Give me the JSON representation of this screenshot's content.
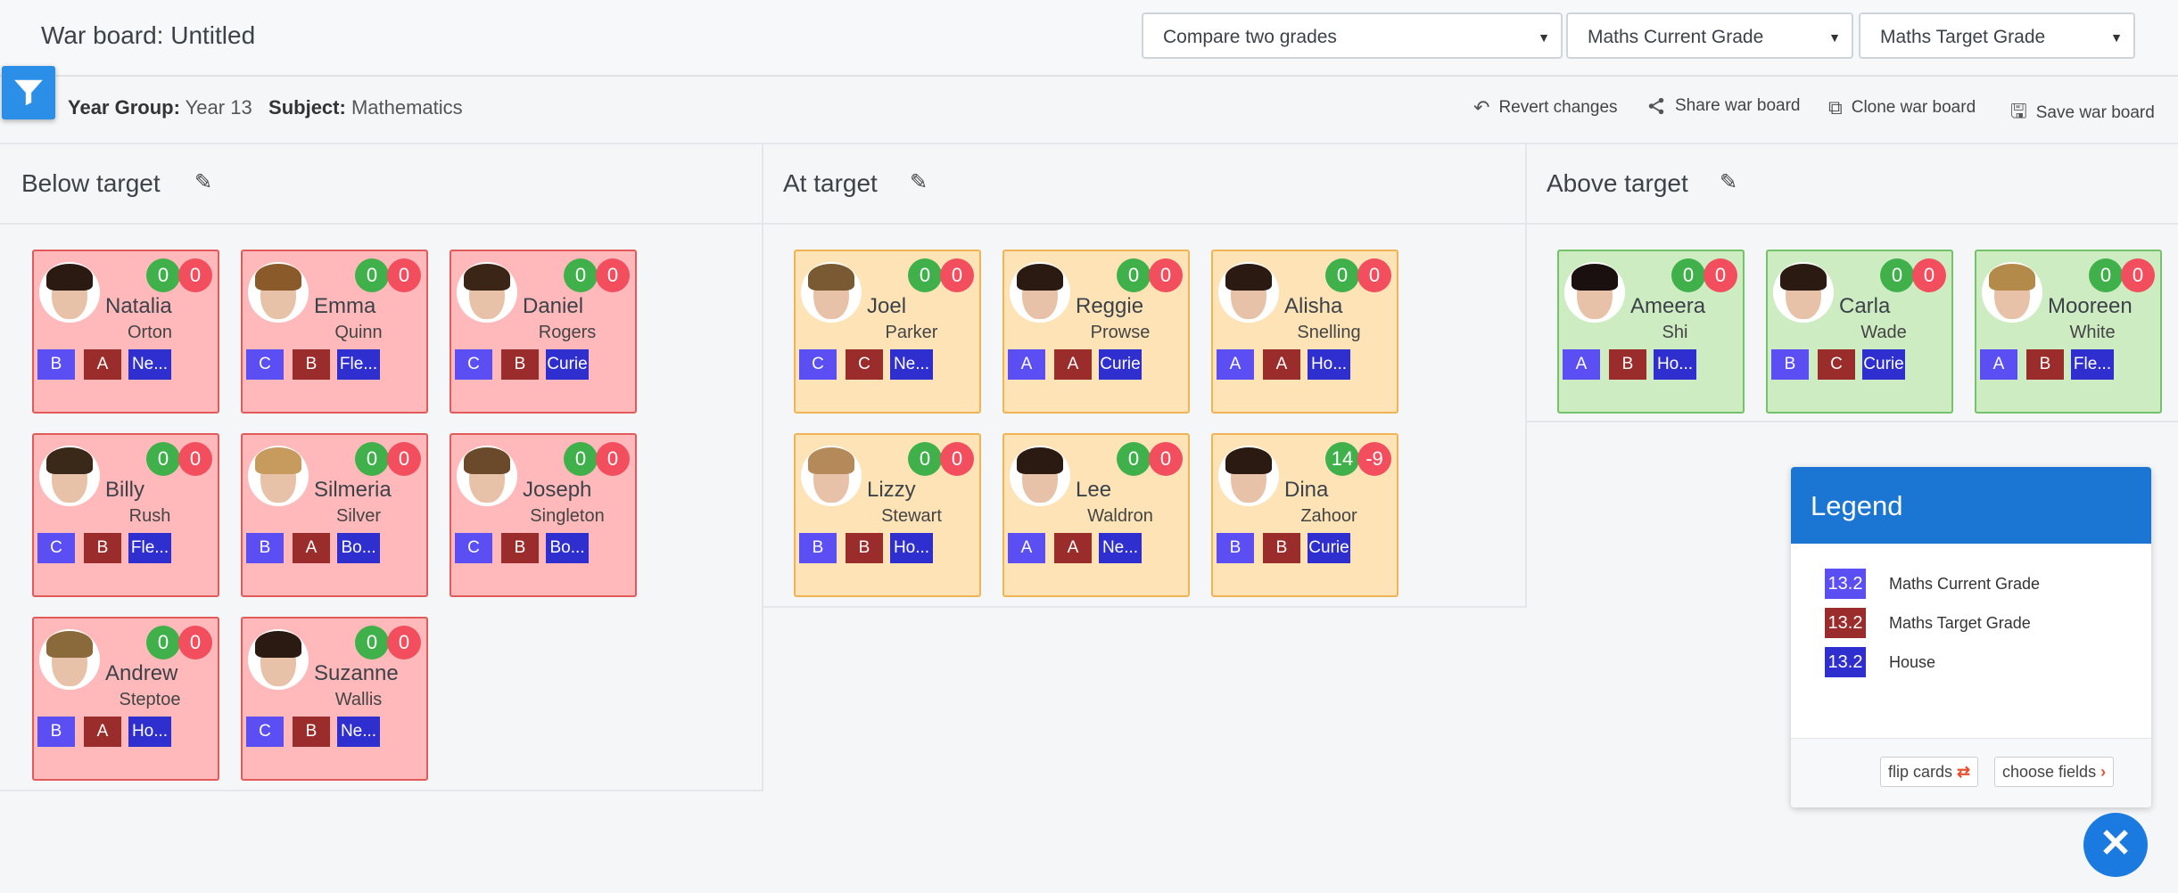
{
  "header": {
    "title": "War board: Untitled",
    "selects": [
      "Compare two grades",
      "Maths Current Grade",
      "Maths Target Grade"
    ]
  },
  "toolbar": {
    "year_group_label": "Year Group:",
    "year_group_value": "Year 13",
    "subject_label": "Subject:",
    "subject_value": "Mathematics",
    "actions": [
      "Revert changes",
      "Share war board",
      "Clone war board",
      "Save war board"
    ]
  },
  "columns": [
    {
      "title": "Below target"
    },
    {
      "title": "At target"
    },
    {
      "title": "Above target"
    }
  ],
  "cards": [
    {
      "first": "Natalia",
      "last": "Orton",
      "g": "0",
      "r": "0",
      "t1": "B",
      "t2": "A",
      "t3": "Ne...",
      "col": "red"
    },
    {
      "first": "Emma",
      "last": "Quinn",
      "g": "0",
      "r": "0",
      "t1": "C",
      "t2": "B",
      "t3": "Fle...",
      "col": "red"
    },
    {
      "first": "Daniel",
      "last": "Rogers",
      "g": "0",
      "r": "0",
      "t1": "C",
      "t2": "B",
      "t3": "Curie",
      "col": "red"
    },
    {
      "first": "Billy",
      "last": "Rush",
      "g": "0",
      "r": "0",
      "t1": "C",
      "t2": "B",
      "t3": "Fle...",
      "col": "red"
    },
    {
      "first": "Silmeria",
      "last": "Silver",
      "g": "0",
      "r": "0",
      "t1": "B",
      "t2": "A",
      "t3": "Bo...",
      "col": "red"
    },
    {
      "first": "Joseph",
      "last": "Singleton",
      "g": "0",
      "r": "0",
      "t1": "C",
      "t2": "B",
      "t3": "Bo...",
      "col": "red"
    },
    {
      "first": "Andrew",
      "last": "Steptoe",
      "g": "0",
      "r": "0",
      "t1": "B",
      "t2": "A",
      "t3": "Ho...",
      "col": "red"
    },
    {
      "first": "Suzanne",
      "last": "Wallis",
      "g": "0",
      "r": "0",
      "t1": "C",
      "t2": "B",
      "t3": "Ne...",
      "col": "red"
    },
    {
      "first": "Joel",
      "last": "Parker",
      "g": "0",
      "r": "0",
      "t1": "C",
      "t2": "C",
      "t3": "Ne...",
      "col": "amber"
    },
    {
      "first": "Reggie",
      "last": "Prowse",
      "g": "0",
      "r": "0",
      "t1": "A",
      "t2": "A",
      "t3": "Curie",
      "col": "amber"
    },
    {
      "first": "Alisha",
      "last": "Snelling",
      "g": "0",
      "r": "0",
      "t1": "A",
      "t2": "A",
      "t3": "Ho...",
      "col": "amber"
    },
    {
      "first": "Lizzy",
      "last": "Stewart",
      "g": "0",
      "r": "0",
      "t1": "B",
      "t2": "B",
      "t3": "Ho...",
      "col": "amber"
    },
    {
      "first": "Lee",
      "last": "Waldron",
      "g": "0",
      "r": "0",
      "t1": "A",
      "t2": "A",
      "t3": "Ne...",
      "col": "amber"
    },
    {
      "first": "Dina",
      "last": "Zahoor",
      "g": "14",
      "r": "-9",
      "t1": "B",
      "t2": "B",
      "t3": "Curie",
      "col": "amber"
    },
    {
      "first": "Ameera",
      "last": "Shi",
      "g": "0",
      "r": "0",
      "t1": "A",
      "t2": "B",
      "t3": "Ho...",
      "col": "green"
    },
    {
      "first": "Carla",
      "last": "Wade",
      "g": "0",
      "r": "0",
      "t1": "B",
      "t2": "C",
      "t3": "Curie",
      "col": "green"
    },
    {
      "first": "Mooreen",
      "last": "White",
      "g": "0",
      "r": "0",
      "t1": "A",
      "t2": "B",
      "t3": "Fle...",
      "col": "green"
    }
  ],
  "legend": {
    "title": "Legend",
    "rows": [
      {
        "value": "13.2",
        "label": "Maths Current Grade"
      },
      {
        "value": "13.2",
        "label": "Maths Target Grade"
      },
      {
        "value": "13.2",
        "label": "House"
      }
    ],
    "flip_label": "flip cards",
    "choose_label": "choose fields"
  },
  "colors": {
    "accent": "#1a76d2",
    "below": "#ffb9bb",
    "at": "#fde3b6",
    "above": "#cdecc2"
  }
}
